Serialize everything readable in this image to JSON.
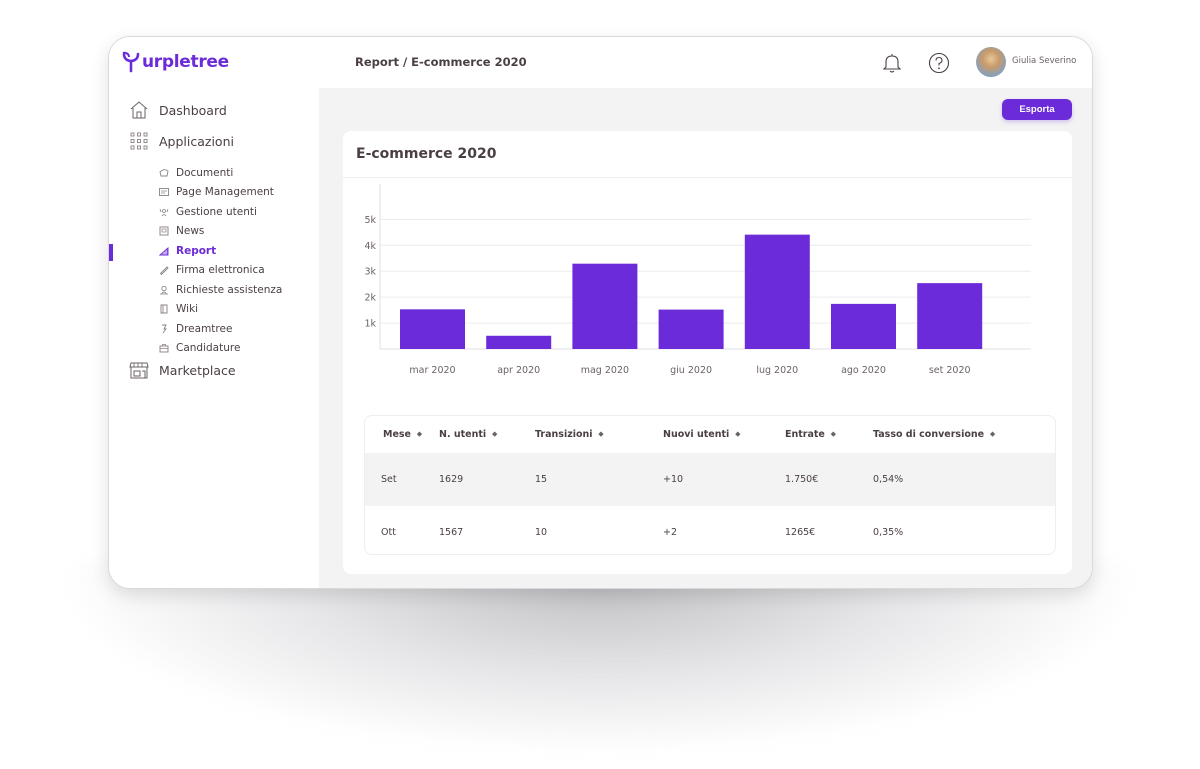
{
  "app": {
    "logo_text": "urpletree",
    "accent_color": "#6c2bd9"
  },
  "sidebar": {
    "main_items": [
      {
        "label": "Dashboard",
        "icon": "home-icon"
      },
      {
        "label": "Applicazioni",
        "icon": "grid-icon"
      },
      {
        "label": "Marketplace",
        "icon": "store-icon"
      }
    ],
    "sub_items": [
      {
        "label": "Documenti",
        "icon": "documents-icon"
      },
      {
        "label": "Page Management",
        "icon": "page-icon"
      },
      {
        "label": "Gestione utenti",
        "icon": "users-icon"
      },
      {
        "label": "News",
        "icon": "news-icon"
      },
      {
        "label": "Report",
        "icon": "report-icon",
        "active": true
      },
      {
        "label": "Firma elettronica",
        "icon": "pen-icon"
      },
      {
        "label": "Richieste assistenza",
        "icon": "support-icon"
      },
      {
        "label": "Wiki",
        "icon": "book-icon"
      },
      {
        "label": "Dreamtree",
        "icon": "bulb-icon"
      },
      {
        "label": "Candidature",
        "icon": "briefcase-icon"
      }
    ]
  },
  "header": {
    "breadcrumb": "Report / E-commerce 2020",
    "user_name": "Giulia Severino"
  },
  "toolbar": {
    "export_label": "Esporta"
  },
  "card": {
    "title": "E-commerce 2020"
  },
  "chart_data": {
    "type": "bar",
    "title": "",
    "xlabel": "",
    "ylabel": "",
    "categories": [
      "mar 2020",
      "apr 2020",
      "mag 2020",
      "giu 2020",
      "lug 2020",
      "ago 2020",
      "set 2020"
    ],
    "values": [
      1530,
      510,
      3290,
      1520,
      4410,
      1740,
      2540
    ],
    "ylim": [
      0,
      5900
    ],
    "yticks": [
      1000,
      2000,
      3000,
      4000,
      5000
    ],
    "ytick_labels": [
      "1k",
      "2k",
      "3k",
      "4k",
      "5k"
    ],
    "grid": true,
    "legend": "none",
    "bar_color": "#6c2bd9"
  },
  "table": {
    "columns": [
      "Mese",
      "N. utenti",
      "Transizioni",
      "Nuovi utenti",
      "Entrate",
      "Tasso di conversione"
    ],
    "rows": [
      [
        "Set",
        "1629",
        "15",
        "+10",
        "1.750€",
        "0,54%"
      ],
      [
        "Ott",
        "1567",
        "10",
        "+2",
        "1265€",
        "0,35%"
      ]
    ]
  }
}
